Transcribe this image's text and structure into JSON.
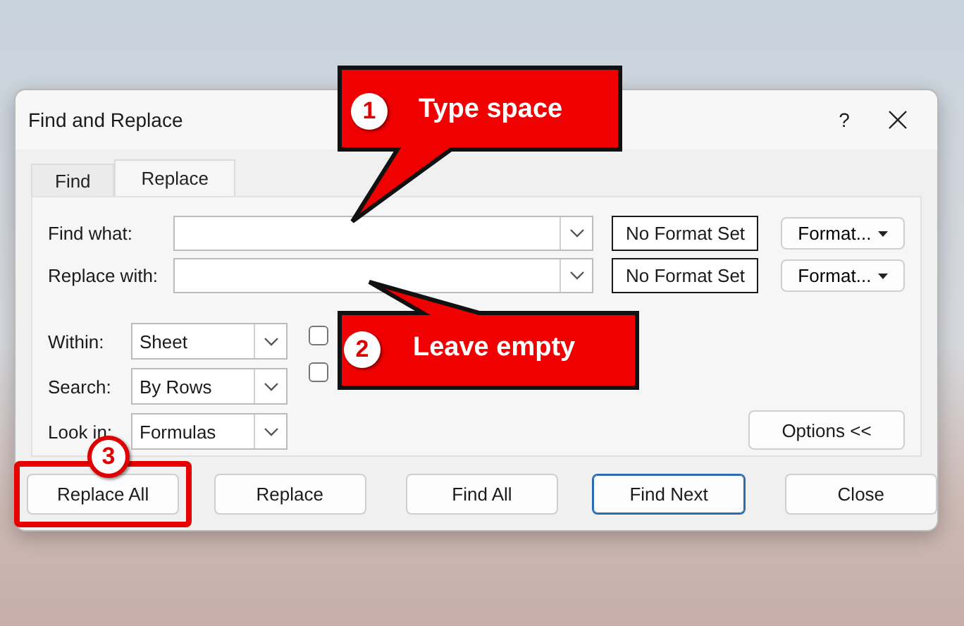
{
  "window": {
    "title": "Find and Replace",
    "help": "?"
  },
  "tabs": [
    {
      "label": "Find",
      "selected": false
    },
    {
      "label": "Replace",
      "selected": true
    }
  ],
  "fields": [
    {
      "label": "Find what:",
      "format_status": "No Format Set",
      "format_button": "Format..."
    },
    {
      "label": "Replace with:",
      "format_status": "No Format Set",
      "format_button": "Format..."
    }
  ],
  "dropdowns": [
    {
      "label": "Within:",
      "value": "Sheet"
    },
    {
      "label": "Search:",
      "value": "By Rows"
    },
    {
      "label": "Look in:",
      "value": "Formulas"
    }
  ],
  "checkboxes": [
    {
      "checked": false
    },
    {
      "checked": false
    }
  ],
  "options_button": "Options <<",
  "buttons": [
    {
      "label": "Replace All",
      "default": false,
      "highlighted": true
    },
    {
      "label": "Replace",
      "default": false,
      "highlighted": false
    },
    {
      "label": "Find All",
      "default": false,
      "highlighted": false
    },
    {
      "label": "Find Next",
      "default": true,
      "highlighted": false
    },
    {
      "label": "Close",
      "default": false,
      "highlighted": false
    }
  ],
  "annotations": [
    {
      "number": "1",
      "text": "Type space",
      "kind": "callout-down"
    },
    {
      "number": "2",
      "text": "Leave empty",
      "kind": "callout-up"
    },
    {
      "number": "3",
      "kind": "badge"
    }
  ]
}
